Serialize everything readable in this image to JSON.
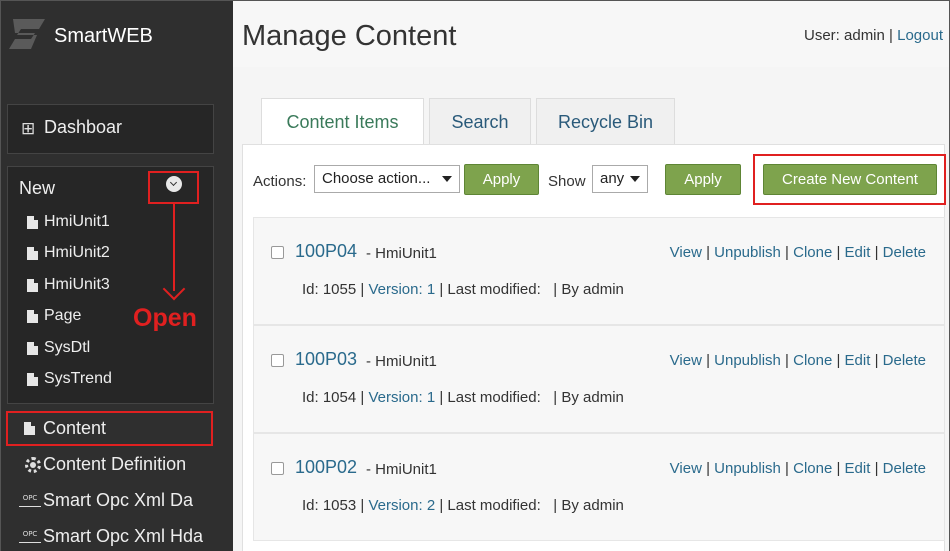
{
  "brand": {
    "name": "SmartWEB"
  },
  "sidebar": {
    "dashboard": "Dashboar",
    "new_title": "New",
    "new_items": [
      "HmiUnit1",
      "HmiUnit2",
      "HmiUnit3",
      "Page",
      "SysDtl",
      "SysTrend"
    ],
    "links": [
      "Content",
      "Content Definition",
      "Smart Opc Xml Da",
      "Smart Opc Xml Hda"
    ],
    "opc_icon_text": "OPC",
    "annotation": "Open"
  },
  "header": {
    "title": "Manage Content",
    "user_prefix": "User: admin |",
    "logout": "Logout"
  },
  "tabs": [
    "Content Items",
    "Search",
    "Recycle Bin"
  ],
  "toolbar": {
    "actions_label": "Actions:",
    "actions_value": "Choose action...",
    "apply1": "Apply",
    "show_label": "Show",
    "show_value": "any",
    "apply2": "Apply",
    "create": "Create New Content"
  },
  "items": [
    {
      "name": "100P04",
      "type": "- HmiUnit1",
      "id": "Id: 1055 |",
      "version": "Version: 1",
      "rest": " | Last modified:   | By admin"
    },
    {
      "name": "100P03",
      "type": "- HmiUnit1",
      "id": "Id: 1054 |",
      "version": "Version: 1",
      "rest": " | Last modified:   | By admin"
    },
    {
      "name": "100P02",
      "type": "- HmiUnit1",
      "id": "Id: 1053 |",
      "version": "Version: 2",
      "rest": " | Last modified:   | By admin"
    }
  ],
  "item_links": {
    "view": "View",
    "unpublish": "Unpublish",
    "clone": "Clone",
    "edit": "Edit",
    "delete": "Delete",
    "sep": " | "
  },
  "colors": {
    "sidebar": "#2f2f2f",
    "accent_green": "#7ea34d",
    "link": "#2a6a8c",
    "highlight_red": "#e02020"
  }
}
